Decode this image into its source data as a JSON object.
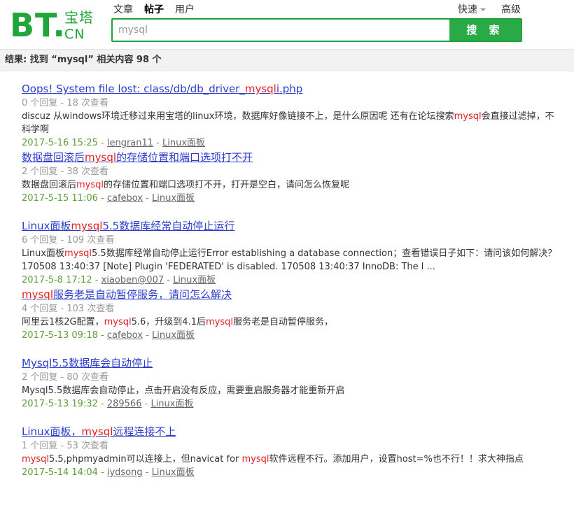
{
  "logo": {
    "bt": "BT.",
    "cn_top": "宝塔",
    "cn_bottom": "CN"
  },
  "nav": {
    "tabs": [
      "文章",
      "帖子",
      "用户"
    ],
    "active_index": 1
  },
  "top_right": {
    "quick": "快速",
    "advanced": "高级"
  },
  "search": {
    "value": "mysql",
    "button": "搜 索"
  },
  "result_summary": "结果: 找到 “mysql” 相关内容 98 个",
  "highlight_color": "#e52020",
  "results": [
    {
      "title": [
        {
          "t": "Oops! System file lost: class/db/db_driver_"
        },
        {
          "t": "mysql",
          "hl": true
        },
        {
          "t": "i.php"
        }
      ],
      "replies": "0 个回复",
      "views": "18 次查看",
      "desc": [
        {
          "t": "discuz 从windows环境迁移过来用宝塔的linux环境，数据库好像链接不上，是什么原因呢 还有在论坛搜索"
        },
        {
          "t": "mysql",
          "hl": true
        },
        {
          "t": "会直接过滤掉，不科学啊"
        }
      ],
      "date": "2017-5-16 15:25",
      "user": "lengran11",
      "forum": "Linux面板"
    },
    {
      "title": [
        {
          "t": "数据盘回滚后"
        },
        {
          "t": "mysql",
          "hl": true
        },
        {
          "t": "的存储位置和端口选项打不开"
        }
      ],
      "replies": "2 个回复",
      "views": "38 次查看",
      "desc": [
        {
          "t": "数据盘回滚后"
        },
        {
          "t": "mysql",
          "hl": true
        },
        {
          "t": "的存储位置和端口选项打不开，打开是空白，请问怎么恢复呢"
        }
      ],
      "date": "2017-5-15 11:06",
      "user": "cafebox",
      "forum": "Linux面板"
    },
    {
      "title": [
        {
          "t": "Linux面板"
        },
        {
          "t": "mysql",
          "hl": true
        },
        {
          "t": "5.5数据库经常自动停止运行"
        }
      ],
      "replies": "6 个回复",
      "views": "109 次查看",
      "desc": [
        {
          "t": "Linux面板"
        },
        {
          "t": "mysql",
          "hl": true
        },
        {
          "t": "5.5数据库经常自动停止运行Error establishing a database connection；查看错误日子如下：请问该如何解决？ 170508 13:40:37 [Note] Plugin 'FEDERATED' is disabled. 170508 13:40:37 InnoDB: The l ..."
        }
      ],
      "date": "2017-5-8 17:12",
      "user": "xiaoben@007",
      "forum": "Linux面板"
    },
    {
      "title": [
        {
          "t": "mysql",
          "hl": true
        },
        {
          "t": "服务老是自动暂停服务，请问怎么解决"
        }
      ],
      "replies": "4 个回复",
      "views": "103 次查看",
      "desc": [
        {
          "t": "阿里云1核2G配置，"
        },
        {
          "t": "mysql",
          "hl": true
        },
        {
          "t": "5.6，升级到4.1后"
        },
        {
          "t": "mysql",
          "hl": true
        },
        {
          "t": "服务老是自动暂停服务，"
        }
      ],
      "date": "2017-5-13 09:18",
      "user": "cafebox",
      "forum": "Linux面板"
    },
    {
      "title": [
        {
          "t": "Mysql5.5数据库会自动停止"
        }
      ],
      "replies": "2 个回复",
      "views": "80 次查看",
      "desc": [
        {
          "t": "Mysql5.5数据库会自动停止，点击开启没有反应，需要重启服务器才能重新开启"
        }
      ],
      "date": "2017-5-13 19:32",
      "user": "289566",
      "forum": "Linux面板"
    },
    {
      "title": [
        {
          "t": "Linux面板，"
        },
        {
          "t": "mysql",
          "hl": true
        },
        {
          "t": "远程连接不上"
        }
      ],
      "replies": "1 个回复",
      "views": "53 次查看",
      "desc": [
        {
          "t": "mysql",
          "hl": true
        },
        {
          "t": "5.5,phpmyadmin可以连接上，但navicat for "
        },
        {
          "t": "mysql",
          "hl": true
        },
        {
          "t": "软件远程不行。添加用户，设置host=%也不行！！求大神指点"
        }
      ],
      "date": "2017-5-14 14:04",
      "user": "iydsong",
      "forum": "Linux面板"
    }
  ]
}
